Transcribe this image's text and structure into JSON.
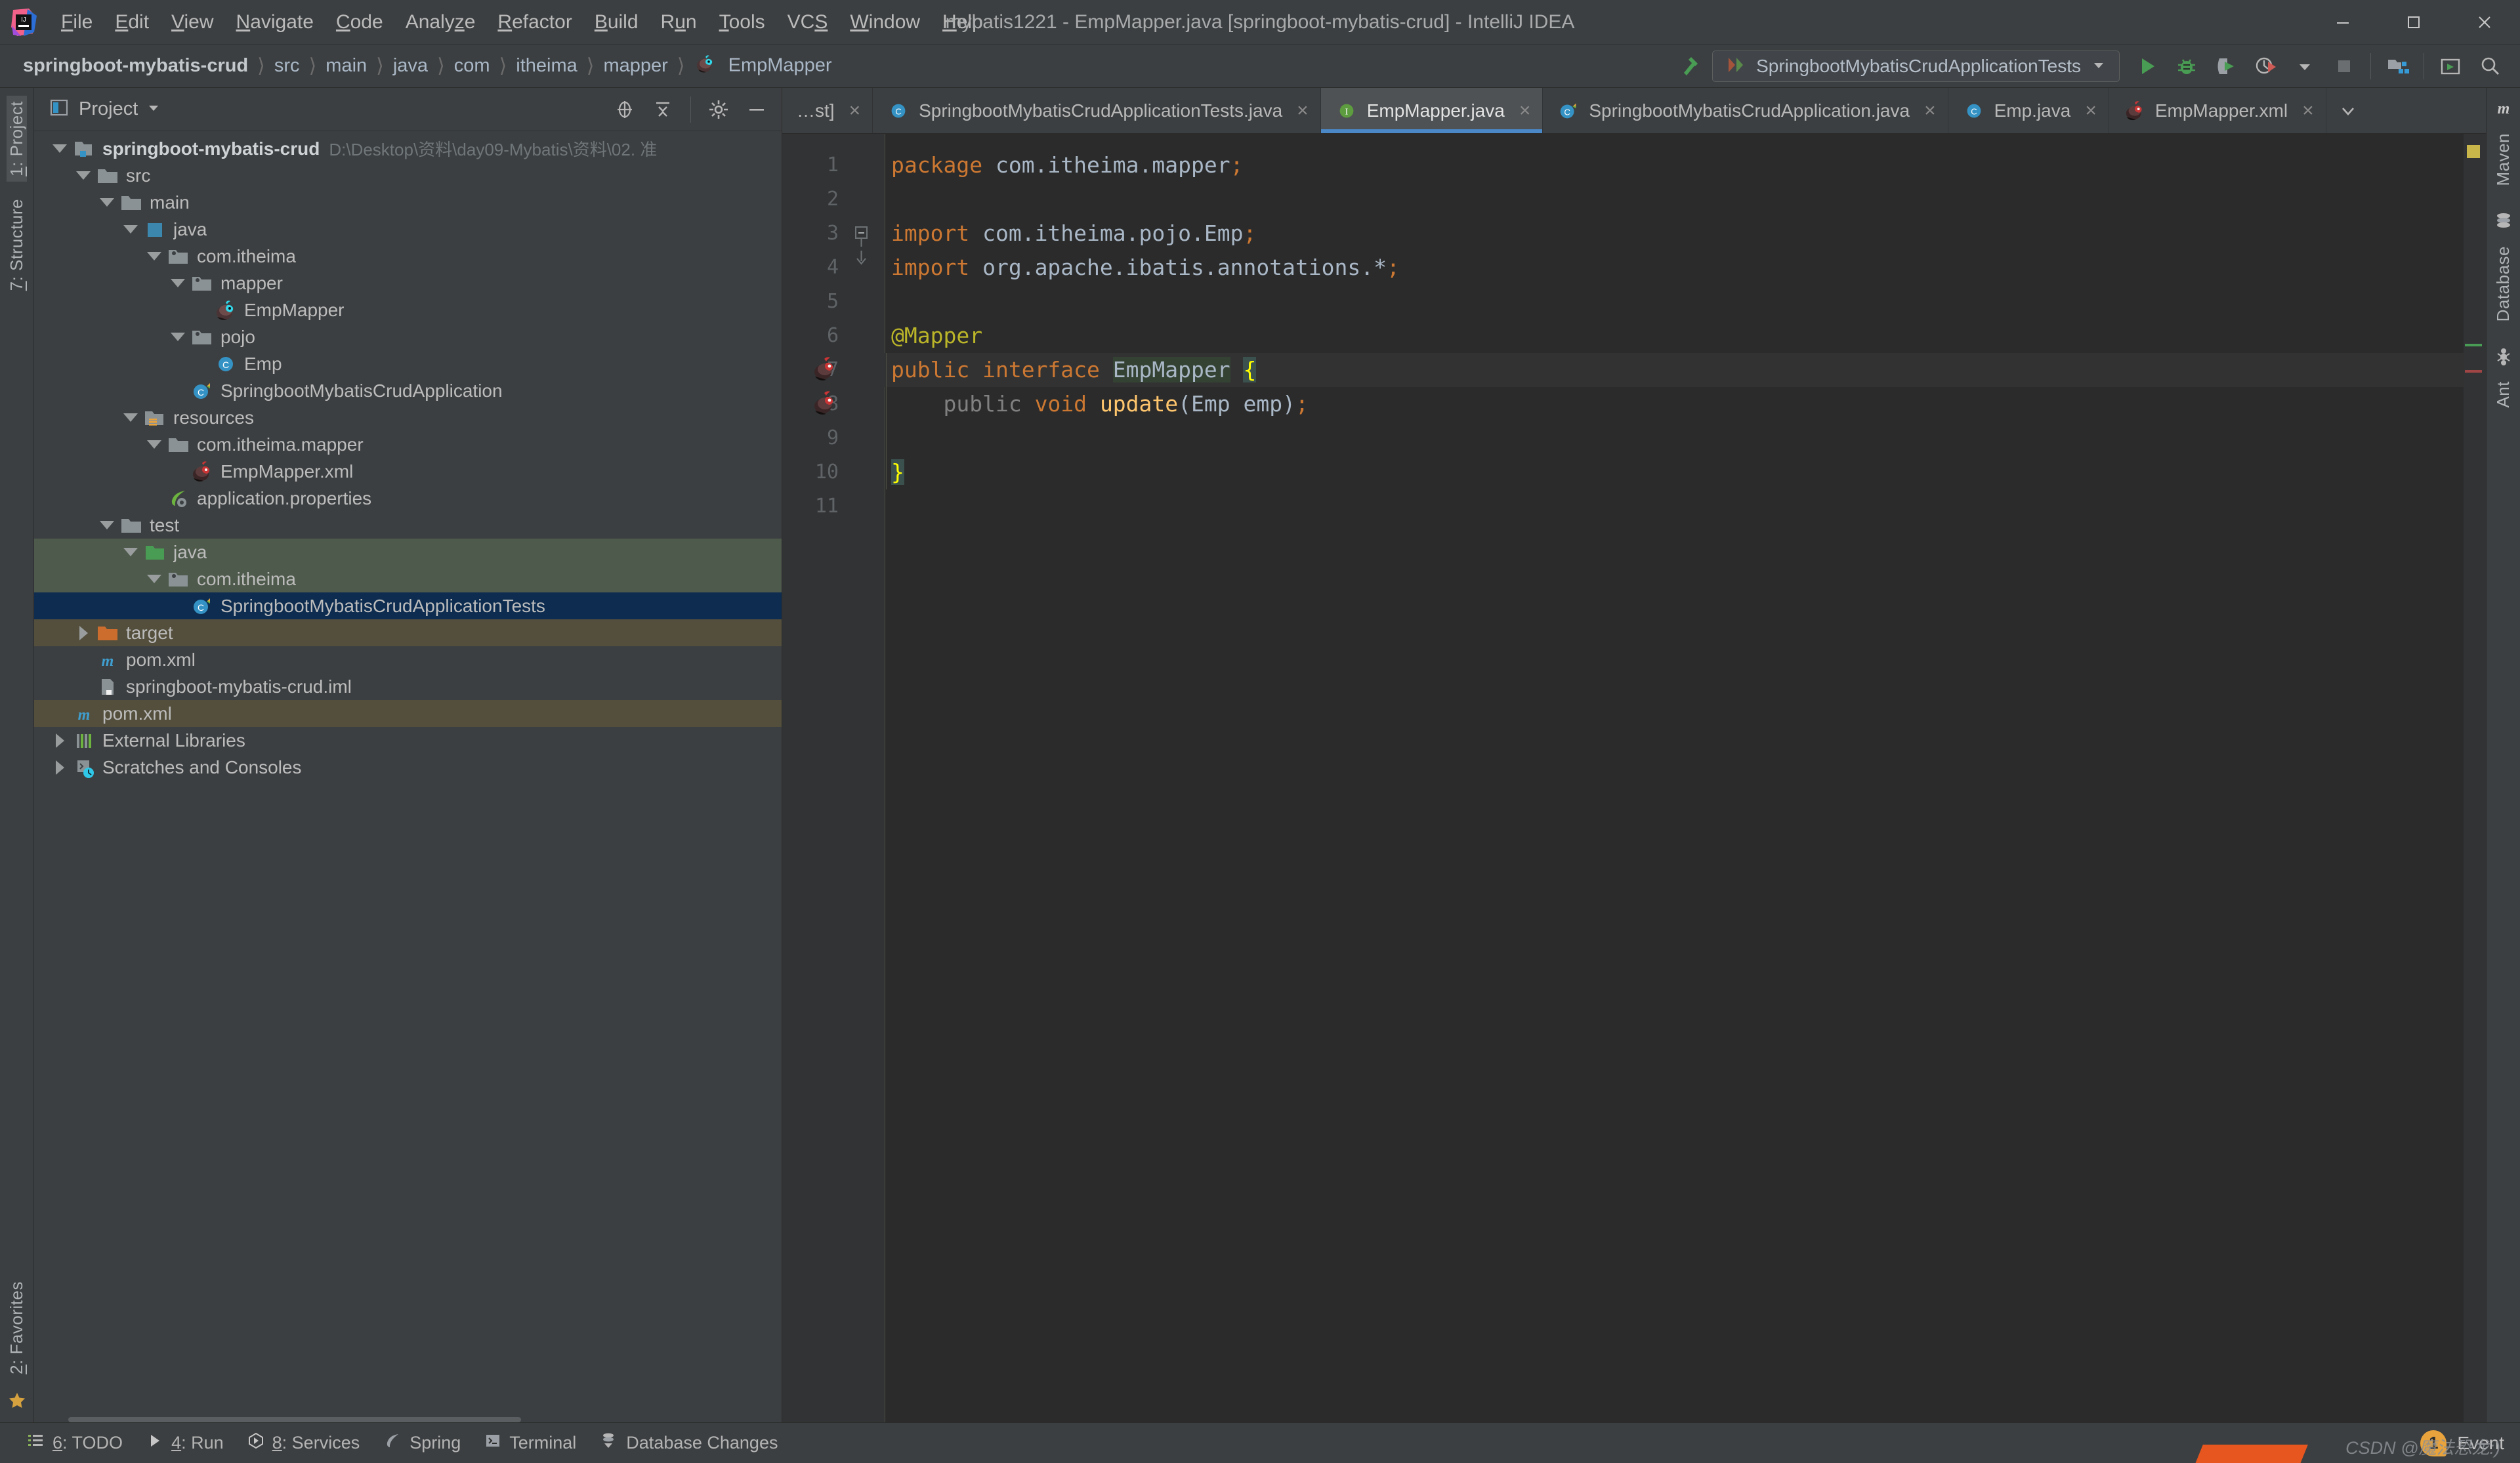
{
  "window": {
    "title": "mybatis1221 - EmpMapper.java [springboot-mybatis-crud] - IntelliJ IDEA",
    "minimize_label": "minimize-icon",
    "maximize_label": "maximize-icon",
    "close_label": "close-icon"
  },
  "menu": [
    {
      "label": "File",
      "mn": "F"
    },
    {
      "label": "Edit",
      "mn": "E"
    },
    {
      "label": "View",
      "mn": "V"
    },
    {
      "label": "Navigate",
      "mn": "N"
    },
    {
      "label": "Code",
      "mn": "C"
    },
    {
      "label": "Analyze",
      "mn": "z"
    },
    {
      "label": "Refactor",
      "mn": "R"
    },
    {
      "label": "Build",
      "mn": "B"
    },
    {
      "label": "Run",
      "mn": "u"
    },
    {
      "label": "Tools",
      "mn": "T"
    },
    {
      "label": "VCS",
      "mn": "S"
    },
    {
      "label": "Window",
      "mn": "W"
    },
    {
      "label": "Help",
      "mn": "H"
    }
  ],
  "breadcrumbs": [
    {
      "label": "springboot-mybatis-crud",
      "icon": "",
      "root": true
    },
    {
      "label": "src",
      "icon": ""
    },
    {
      "label": "main",
      "icon": ""
    },
    {
      "label": "java",
      "icon": ""
    },
    {
      "label": "com",
      "icon": ""
    },
    {
      "label": "itheima",
      "icon": ""
    },
    {
      "label": "mapper",
      "icon": ""
    },
    {
      "label": "EmpMapper",
      "icon": "mybatis-mapper-icon"
    }
  ],
  "toolbar": {
    "make_icon": "build-hammer-icon",
    "run_config": {
      "label": "SpringbootMybatisCrudApplicationTests",
      "icon": "junit-test-icon",
      "dropdown_icon": "chevron-down-icon"
    },
    "buttons": [
      {
        "name": "run-button",
        "icon": "play-icon",
        "title": "Run"
      },
      {
        "name": "debug-button",
        "icon": "debug-bug-icon",
        "title": "Debug"
      },
      {
        "name": "run-coverage-button",
        "icon": "coverage-shield-icon",
        "title": "Run with Coverage"
      },
      {
        "name": "profiler-button",
        "icon": "profiler-clock-icon",
        "title": "Profiler"
      },
      {
        "name": "profiler-dropdown",
        "icon": "chevron-down-icon",
        "title": "More"
      },
      {
        "name": "stop-button",
        "icon": "stop-square-icon",
        "title": "Stop"
      },
      {
        "name": "project-structure-button",
        "icon": "project-structure-icon",
        "title": "Project Structure"
      },
      {
        "name": "updates-button",
        "icon": "terminal-window-icon",
        "title": "Run Anything"
      },
      {
        "name": "search-everywhere-button",
        "icon": "search-icon",
        "title": "Search Everywhere"
      }
    ]
  },
  "left_strip": {
    "items": [
      {
        "label": "1: Project",
        "mn": "1",
        "selected": true,
        "icon": ""
      },
      {
        "label": "7: Structure",
        "mn": "7",
        "selected": false,
        "icon": ""
      }
    ],
    "bottom_items": [
      {
        "label": "2: Favorites",
        "mn": "2",
        "icon": "star-icon"
      }
    ],
    "bookmark_icon": "star-icon"
  },
  "project_panel": {
    "title": "Project",
    "title_icon": "project-view-icon",
    "dropdown_icon": "chevron-down-icon",
    "tools": [
      {
        "name": "scroll-from-source-button",
        "icon": "target-crosshair-icon"
      },
      {
        "name": "collapse-all-button",
        "icon": "collapse-all-icon"
      },
      {
        "name": "settings-button",
        "icon": "gear-icon"
      },
      {
        "name": "hide-button",
        "icon": "minus-icon"
      }
    ],
    "tree": [
      {
        "label": "springboot-mybatis-crud",
        "path": "D:\\Desktop\\资料\\day09-Mybatis\\资料\\02. 准",
        "depth": 0,
        "arrow": "down",
        "icon": "module-icon",
        "bold": true,
        "sel": ""
      },
      {
        "label": "src",
        "path": "",
        "depth": 1,
        "arrow": "down",
        "icon": "folder-icon",
        "bold": false,
        "sel": ""
      },
      {
        "label": "main",
        "path": "",
        "depth": 2,
        "arrow": "down",
        "icon": "folder-icon",
        "bold": false,
        "sel": ""
      },
      {
        "label": "java",
        "path": "",
        "depth": 3,
        "arrow": "down",
        "icon": "source-root-icon",
        "bold": false,
        "sel": ""
      },
      {
        "label": "com.itheima",
        "path": "",
        "depth": 4,
        "arrow": "down",
        "icon": "package-icon",
        "bold": false,
        "sel": ""
      },
      {
        "label": "mapper",
        "path": "",
        "depth": 5,
        "arrow": "down",
        "icon": "package-icon",
        "bold": false,
        "sel": ""
      },
      {
        "label": "EmpMapper",
        "path": "",
        "depth": 6,
        "arrow": "none",
        "icon": "mybatis-mapper-icon",
        "bold": false,
        "sel": ""
      },
      {
        "label": "pojo",
        "path": "",
        "depth": 5,
        "arrow": "down",
        "icon": "package-icon",
        "bold": false,
        "sel": ""
      },
      {
        "label": "Emp",
        "path": "",
        "depth": 6,
        "arrow": "none",
        "icon": "java-class-icon",
        "bold": false,
        "sel": ""
      },
      {
        "label": "SpringbootMybatisCrudApplication",
        "path": "",
        "depth": 5,
        "arrow": "none",
        "icon": "spring-boot-class-icon",
        "bold": false,
        "sel": ""
      },
      {
        "label": "resources",
        "path": "",
        "depth": 3,
        "arrow": "down",
        "icon": "resources-root-icon",
        "bold": false,
        "sel": ""
      },
      {
        "label": "com.itheima.mapper",
        "path": "",
        "depth": 4,
        "arrow": "down",
        "icon": "folder-icon",
        "bold": false,
        "sel": ""
      },
      {
        "label": "EmpMapper.xml",
        "path": "",
        "depth": 5,
        "arrow": "none",
        "icon": "mybatis-xml-icon",
        "bold": false,
        "sel": ""
      },
      {
        "label": "application.properties",
        "path": "",
        "depth": 4,
        "arrow": "none",
        "icon": "spring-properties-icon",
        "bold": false,
        "sel": ""
      },
      {
        "label": "test",
        "path": "",
        "depth": 2,
        "arrow": "down",
        "icon": "folder-icon",
        "bold": false,
        "sel": ""
      },
      {
        "label": "java",
        "path": "",
        "depth": 3,
        "arrow": "down",
        "icon": "test-source-root-icon",
        "bold": false,
        "sel": "sel-green"
      },
      {
        "label": "com.itheima",
        "path": "",
        "depth": 4,
        "arrow": "down",
        "icon": "package-icon",
        "bold": false,
        "sel": "sel-green"
      },
      {
        "label": "SpringbootMybatisCrudApplicationTests",
        "path": "",
        "depth": 5,
        "arrow": "none",
        "icon": "spring-boot-class-icon",
        "bold": false,
        "sel": "sel-blue"
      },
      {
        "label": "target",
        "path": "",
        "depth": 1,
        "arrow": "right",
        "icon": "excluded-folder-icon",
        "bold": false,
        "sel": "sel-brown"
      },
      {
        "label": "pom.xml",
        "path": "",
        "depth": 1,
        "arrow": "none",
        "icon": "maven-pom-icon",
        "bold": false,
        "sel": ""
      },
      {
        "label": "springboot-mybatis-crud.iml",
        "path": "",
        "depth": 1,
        "arrow": "none",
        "icon": "iml-module-file-icon",
        "bold": false,
        "sel": ""
      },
      {
        "label": "pom.xml",
        "path": "",
        "depth": 0,
        "arrow": "none",
        "icon": "maven-pom-icon",
        "bold": false,
        "sel": "sel-brown"
      },
      {
        "label": "External Libraries",
        "path": "",
        "depth": 0,
        "arrow": "right",
        "icon": "libraries-icon",
        "bold": false,
        "sel": ""
      },
      {
        "label": "Scratches and Consoles",
        "path": "",
        "depth": 0,
        "arrow": "right",
        "icon": "scratches-icon",
        "bold": false,
        "sel": ""
      }
    ]
  },
  "editor": {
    "tabs": [
      {
        "label": "…st]",
        "icon": "none",
        "active": false,
        "clipped": true
      },
      {
        "label": "SpringbootMybatisCrudApplicationTests.java",
        "icon": "java-class-icon",
        "active": false,
        "clipped": false
      },
      {
        "label": "EmpMapper.java",
        "icon": "java-interface-icon",
        "active": true,
        "clipped": false
      },
      {
        "label": "SpringbootMybatisCrudApplication.java",
        "icon": "spring-boot-class-icon",
        "active": false,
        "clipped": false
      },
      {
        "label": "Emp.java",
        "icon": "java-class-icon",
        "active": false,
        "clipped": false
      },
      {
        "label": "EmpMapper.xml",
        "icon": "mybatis-xml-icon",
        "active": false,
        "clipped": false
      }
    ],
    "tab_overflow_icon": "chevron-down-icon",
    "close_icon": "close-icon",
    "line_numbers": [
      "1",
      "2",
      "3",
      "4",
      "5",
      "6",
      "7",
      "8",
      "9",
      "10",
      "11"
    ],
    "lines": [
      {
        "n": "1",
        "tokens": [
          {
            "t": "package",
            "c": "kw"
          },
          {
            "t": " ",
            "c": "id"
          },
          {
            "t": "com.itheima.mapper",
            "c": "id"
          },
          {
            "t": ";",
            "c": "punct"
          }
        ],
        "fold": "none",
        "gutter": "none",
        "hl": false
      },
      {
        "n": "2",
        "tokens": [],
        "fold": "none",
        "gutter": "none",
        "hl": false
      },
      {
        "n": "3",
        "tokens": [
          {
            "t": "import",
            "c": "kw"
          },
          {
            "t": " ",
            "c": "id"
          },
          {
            "t": "com.itheima.pojo.Emp",
            "c": "id"
          },
          {
            "t": ";",
            "c": "punct"
          }
        ],
        "fold": "minus",
        "gutter": "none",
        "hl": false
      },
      {
        "n": "4",
        "tokens": [
          {
            "t": "import",
            "c": "kw"
          },
          {
            "t": " ",
            "c": "id"
          },
          {
            "t": "org.apache.ibatis.annotations.*",
            "c": "id"
          },
          {
            "t": ";",
            "c": "punct"
          }
        ],
        "fold": "end",
        "gutter": "none",
        "hl": false
      },
      {
        "n": "5",
        "tokens": [],
        "fold": "none",
        "gutter": "none",
        "hl": false
      },
      {
        "n": "6",
        "tokens": [
          {
            "t": "@Mapper",
            "c": "ann"
          }
        ],
        "fold": "none",
        "gutter": "none",
        "hl": false
      },
      {
        "n": "7",
        "tokens": [
          {
            "t": "public",
            "c": "kw"
          },
          {
            "t": " ",
            "c": "id"
          },
          {
            "t": "interface",
            "c": "kw"
          },
          {
            "t": " ",
            "c": "id"
          },
          {
            "t": "EmpMapper",
            "c": "id caret-under"
          },
          {
            "t": " ",
            "c": "id"
          },
          {
            "t": "{",
            "c": "brace brace-hl"
          }
        ],
        "fold": "none",
        "gutter": "mybatis-statement-icon",
        "hl": true
      },
      {
        "n": "8",
        "tokens": [
          {
            "t": "    ",
            "c": "id"
          },
          {
            "t": "public",
            "c": "dim"
          },
          {
            "t": " ",
            "c": "id"
          },
          {
            "t": "void",
            "c": "kw"
          },
          {
            "t": " ",
            "c": "id"
          },
          {
            "t": "update",
            "c": "meth"
          },
          {
            "t": "(",
            "c": "id"
          },
          {
            "t": "Emp",
            "c": "id"
          },
          {
            "t": " ",
            "c": "id"
          },
          {
            "t": "emp",
            "c": "id"
          },
          {
            "t": ")",
            "c": "id"
          },
          {
            "t": ";",
            "c": "punct"
          }
        ],
        "fold": "none",
        "gutter": "mybatis-statement-icon",
        "hl": false
      },
      {
        "n": "9",
        "tokens": [],
        "fold": "none",
        "gutter": "none",
        "hl": false
      },
      {
        "n": "10",
        "tokens": [
          {
            "t": "}",
            "c": "brace brace-hl"
          }
        ],
        "fold": "none",
        "gutter": "none",
        "hl": false
      },
      {
        "n": "11",
        "tokens": [],
        "fold": "none",
        "gutter": "none",
        "hl": false
      }
    ],
    "inspection_status": "warning"
  },
  "right_strip": {
    "items": [
      {
        "label": "Maven",
        "icon": "maven-m-icon"
      },
      {
        "label": "Database",
        "icon": "database-icon"
      },
      {
        "label": "Ant",
        "icon": "ant-icon"
      }
    ]
  },
  "statusbar": {
    "items": [
      {
        "label": "6: TODO",
        "mn": "6",
        "icon": "todo-list-icon"
      },
      {
        "label": "4: Run",
        "mn": "4",
        "icon": "play-icon"
      },
      {
        "label": "8: Services",
        "mn": "8",
        "icon": "services-icon"
      },
      {
        "label": "Spring",
        "mn": "",
        "icon": "spring-leaf-icon"
      },
      {
        "label": "Terminal",
        "mn": "",
        "icon": "terminal-icon"
      },
      {
        "label": "Database Changes",
        "mn": "",
        "icon": "database-changes-icon"
      }
    ],
    "event_count": "1",
    "event_label": "Event",
    "watermark": "CSDN @魔法恐龙:)"
  },
  "colors": {
    "bg_chrome": "#3c3f41",
    "bg_editor": "#2b2b2b",
    "gutter": "#313335",
    "accent_blue": "#4a88c7",
    "selection_blue": "#0d2c4f",
    "selection_green": "#4e5a4b",
    "selection_brown": "#544f3c",
    "keyword_orange": "#cc7832",
    "identifier": "#a9b7c6",
    "annotation_yellow": "#bbb529",
    "method_yellow": "#ffc66d",
    "brace_yellow": "#ffff00",
    "run_green": "#499c54",
    "mybatis_red": "#c43b3b",
    "event_amber": "#e8a33d"
  }
}
